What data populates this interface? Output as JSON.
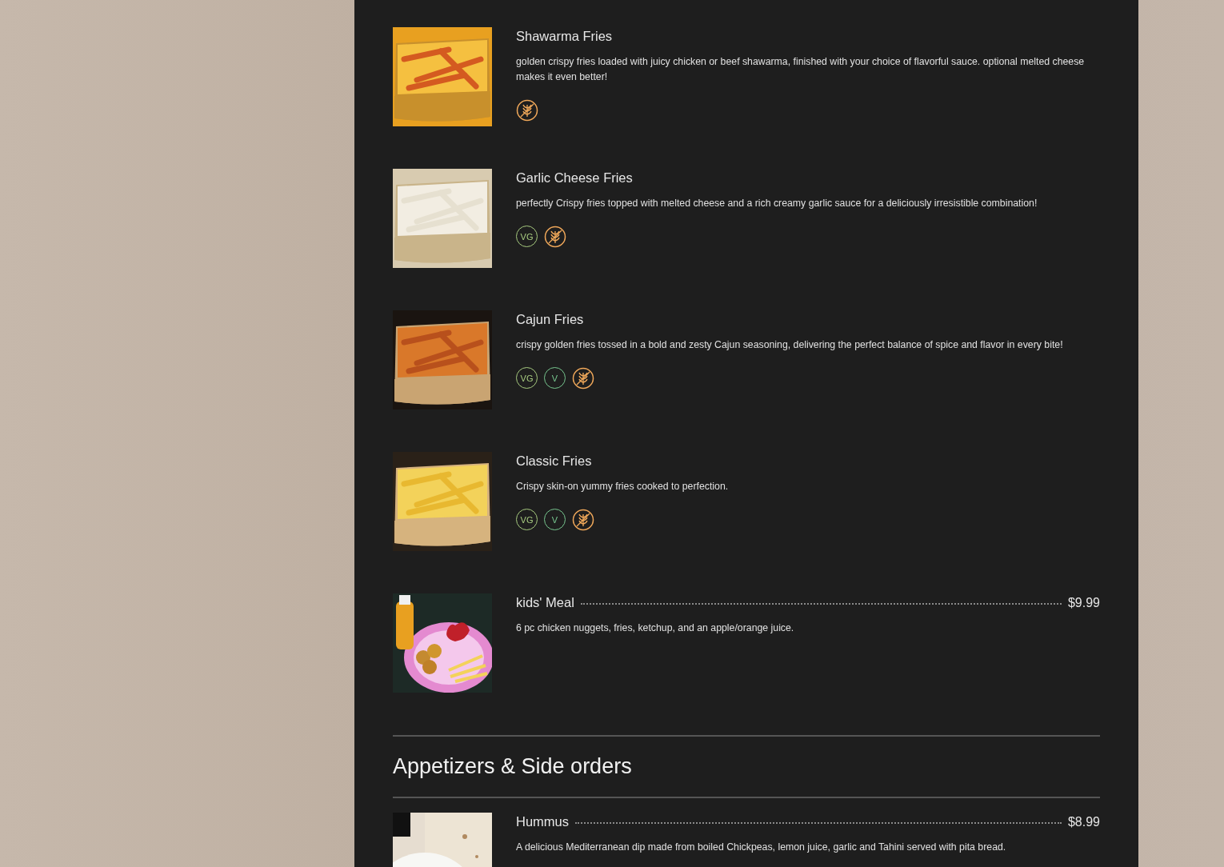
{
  "sections": [
    {
      "items": [
        {
          "name": "Shawarma Fries",
          "description": "golden crispy fries loaded with juicy chicken or beef shawarma, finished with your choice of flavorful sauce. optional melted cheese makes it even better!",
          "picture": {
            "kind": "picture"
          },
          "badges": [
            {
              "kind": "gf"
            }
          ]
        },
        {
          "name": "Garlic Cheese Fries",
          "description": "perfectly Crispy fries topped with melted cheese and a rich creamy garlic sauce for a deliciously irresistible combination!",
          "picture": {
            "kind": "picture"
          },
          "badges": [
            {
              "kind": "vg",
              "label": "VG"
            },
            {
              "kind": "gf"
            }
          ]
        },
        {
          "name": "Cajun Fries",
          "description": "crispy golden fries tossed in a bold and zesty Cajun seasoning, delivering the perfect balance of spice and flavor in every bite!",
          "picture": {
            "kind": "picture"
          },
          "badges": [
            {
              "kind": "vg",
              "label": "VG"
            },
            {
              "kind": "v",
              "label": "V"
            },
            {
              "kind": "gf"
            }
          ]
        },
        {
          "name": "Classic Fries",
          "description": "Crispy skin-on yummy fries cooked to perfection.",
          "picture": {
            "kind": "picture"
          },
          "badges": [
            {
              "kind": "vg",
              "label": "VG"
            },
            {
              "kind": "v",
              "label": "V"
            },
            {
              "kind": "gf"
            }
          ]
        },
        {
          "name": "kids' Meal",
          "price": "$9.99",
          "description": "6 pc chicken nuggets, fries, ketchup, and an apple/orange juice.",
          "picture": {
            "kind": "picture"
          }
        }
      ]
    },
    {
      "title": "Appetizers & Side orders",
      "items": [
        {
          "name": "Hummus",
          "price": "$8.99",
          "description": "A delicious Mediterranean dip made from boiled Chickpeas, lemon juice, garlic and Tahini served with pita bread.",
          "picture": {
            "kind": "picture"
          }
        }
      ]
    }
  ]
}
